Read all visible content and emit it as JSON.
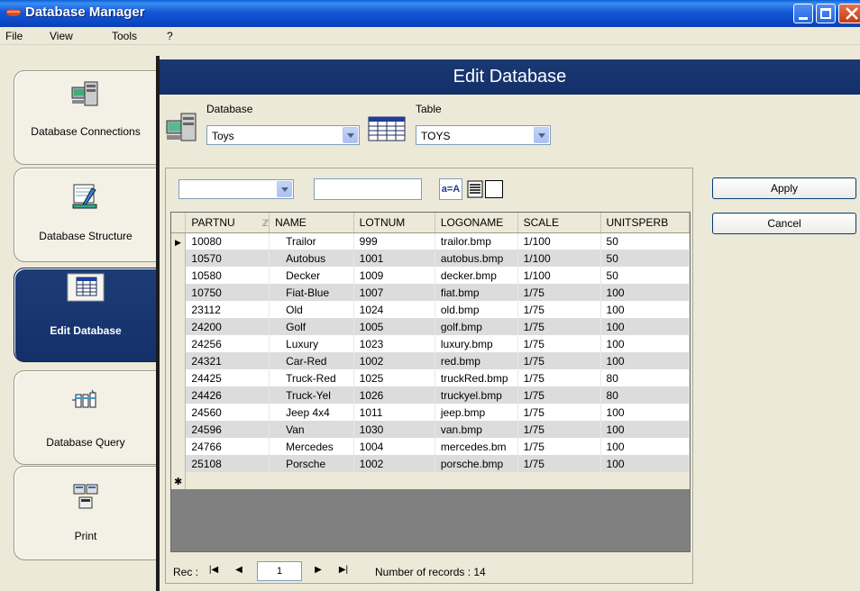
{
  "window": {
    "title": "Database Manager"
  },
  "menu": [
    "File",
    "View",
    "Tools",
    "?"
  ],
  "nav": [
    {
      "label": "Database Connections",
      "icon": "database-connections-icon",
      "active": false
    },
    {
      "label": "Database Structure",
      "icon": "database-structure-icon",
      "active": false
    },
    {
      "label": "Edit Database",
      "icon": "edit-database-icon",
      "active": true
    },
    {
      "label": "Database Query",
      "icon": "database-query-icon",
      "active": false
    },
    {
      "label": "Print",
      "icon": "print-icon",
      "active": false
    }
  ],
  "header": {
    "title": "Edit Database"
  },
  "selectors": {
    "database_label": "Database",
    "database_value": "Toys",
    "table_label": "Table",
    "table_value": "TOYS"
  },
  "filter": {
    "field_value": "",
    "text_value": "",
    "sort_label": "a=A"
  },
  "buttons": {
    "apply": "Apply",
    "cancel": "Cancel"
  },
  "grid": {
    "columns": [
      "PARTNU",
      "NAME",
      "LOTNUM",
      "LOGONAME",
      "SCALE",
      "UNITSPERB"
    ],
    "rows": [
      [
        "10080",
        "Trailor",
        "999",
        "trailor.bmp",
        "1/100",
        "50"
      ],
      [
        "10570",
        "Autobus",
        "1001",
        "autobus.bmp",
        "1/100",
        "50"
      ],
      [
        "10580",
        "Decker",
        "1009",
        "decker.bmp",
        "1/100",
        "50"
      ],
      [
        "10750",
        "Fiat-Blue",
        "1007",
        "fiat.bmp",
        "1/75",
        "100"
      ],
      [
        "23112",
        "Old",
        "1024",
        "old.bmp",
        "1/75",
        "100"
      ],
      [
        "24200",
        "Golf",
        "1005",
        "golf.bmp",
        "1/75",
        "100"
      ],
      [
        "24256",
        "Luxury",
        "1023",
        "luxury.bmp",
        "1/75",
        "100"
      ],
      [
        "24321",
        "Car-Red",
        "1002",
        "red.bmp",
        "1/75",
        "100"
      ],
      [
        "24425",
        "Truck-Red",
        "1025",
        "truckRed.bmp",
        "1/75",
        "80"
      ],
      [
        "24426",
        "Truck-Yel",
        "1026",
        "truckyel.bmp",
        "1/75",
        "80"
      ],
      [
        "24560",
        "Jeep 4x4",
        "1011",
        "jeep.bmp",
        "1/75",
        "100"
      ],
      [
        "24596",
        "Van",
        "1030",
        "van.bmp",
        "1/75",
        "100"
      ],
      [
        "24766",
        "Mercedes",
        "1004",
        "mercedes.bm",
        "1/75",
        "100"
      ],
      [
        "25108",
        "Porsche",
        "1002",
        "porsche.bmp",
        "1/75",
        "100"
      ]
    ],
    "current_row_marker": "▶",
    "new_row_marker": "✱"
  },
  "pager": {
    "rec_label": "Rec :",
    "current": "1",
    "records_label": "Number of records : 14"
  }
}
